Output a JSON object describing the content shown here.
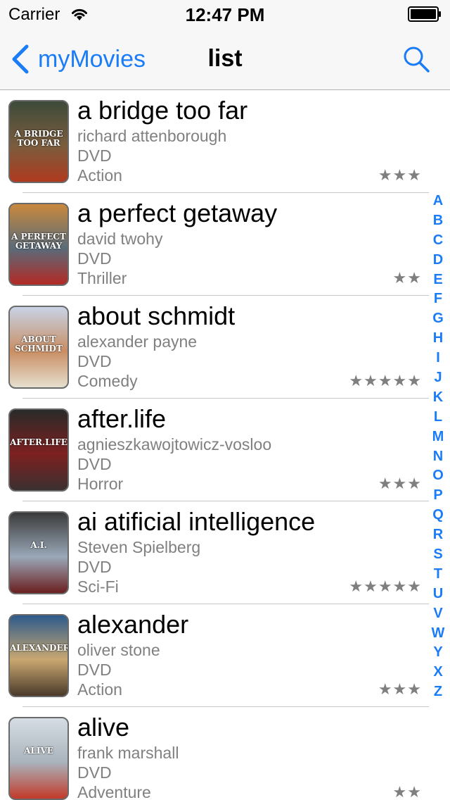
{
  "status_bar": {
    "carrier": "Carrier",
    "time": "12:47 PM"
  },
  "nav": {
    "back_label": "myMovies",
    "title": "list"
  },
  "colors": {
    "accent": "#1a7cf7",
    "secondary_text": "#808080",
    "bar_background": "#f7f7f7"
  },
  "movies": [
    {
      "title": "a bridge too far",
      "director": "richard attenborough",
      "format": "DVD",
      "genre": "Action",
      "rating": 3,
      "stars": "★★★",
      "cover_text": "A BRIDGE TOO FAR",
      "cover_colors": [
        "#3d4a3a",
        "#7a5d3e",
        "#b03a1e"
      ]
    },
    {
      "title": "a perfect getaway",
      "director": "david twohy",
      "format": "DVD",
      "genre": "Thriller",
      "rating": 2,
      "stars": "★★",
      "cover_text": "A PERFECT GETAWAY",
      "cover_colors": [
        "#c9893d",
        "#5a6b7a",
        "#b32a24"
      ]
    },
    {
      "title": "about schmidt",
      "director": "alexander payne",
      "format": "DVD",
      "genre": "Comedy",
      "rating": 5,
      "stars": "★★★★★",
      "cover_text": "ABOUT SCHMIDT",
      "cover_colors": [
        "#c8d3e6",
        "#c98e63",
        "#e6dfcf"
      ]
    },
    {
      "title": "after.life",
      "director": "agnieszkawojtowicz-vosloo",
      "format": "DVD",
      "genre": "Horror",
      "rating": 3,
      "stars": "★★★",
      "cover_text": "AFTER.LIFE",
      "cover_colors": [
        "#2a2a2a",
        "#7d2020",
        "#3b3030"
      ]
    },
    {
      "title": "ai atificial intelligence",
      "director": "Steven Spielberg",
      "format": "DVD",
      "genre": "Sci-Fi",
      "rating": 5,
      "stars": "★★★★★",
      "cover_text": "A.I.",
      "cover_colors": [
        "#3a3a3a",
        "#9aa8b8",
        "#6b1f1f"
      ]
    },
    {
      "title": "alexander",
      "director": "oliver stone",
      "format": "DVD",
      "genre": "Action",
      "rating": 3,
      "stars": "★★★",
      "cover_text": "ALEXANDER",
      "cover_colors": [
        "#2d5a8c",
        "#c9a770",
        "#4a3a2a"
      ]
    },
    {
      "title": "alive",
      "director": "frank marshall",
      "format": "DVD",
      "genre": "Adventure",
      "rating": 2,
      "stars": "★★",
      "cover_text": "ALIVE",
      "cover_colors": [
        "#d6dde4",
        "#a9b3bb",
        "#c23a2a"
      ]
    }
  ],
  "index_letters": [
    "A",
    "B",
    "C",
    "D",
    "E",
    "F",
    "G",
    "H",
    "I",
    "J",
    "K",
    "L",
    "M",
    "N",
    "O",
    "P",
    "Q",
    "R",
    "S",
    "T",
    "U",
    "V",
    "W",
    "Y",
    "X",
    "Z"
  ]
}
